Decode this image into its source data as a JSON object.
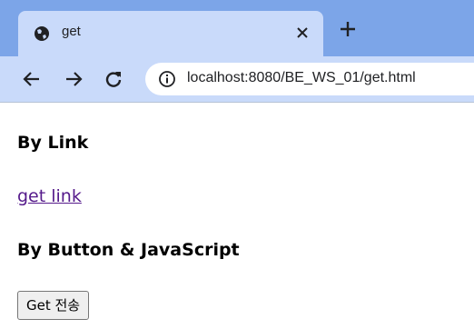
{
  "browser": {
    "tab": {
      "title": "get"
    },
    "address": {
      "url": "localhost:8080/BE_WS_01/get.html"
    },
    "icons": {
      "tab_favicon": "globe-icon",
      "tab_close": "close-icon",
      "new_tab": "plus-icon",
      "back": "arrow-left-icon",
      "forward": "arrow-right-icon",
      "reload": "reload-icon",
      "site_info": "info-icon"
    }
  },
  "page": {
    "link_heading": "By Link",
    "link_text": "get link",
    "button_heading": "By Button & JavaScript",
    "button_label": "Get 전송"
  },
  "colors": {
    "tabstrip": "#7ca5e8",
    "active_tab": "#c9dafa",
    "visited_link": "#551a8b"
  }
}
